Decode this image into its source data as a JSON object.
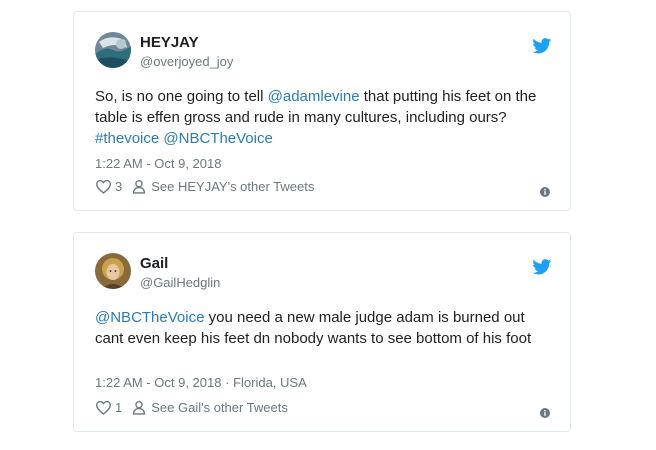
{
  "tweets": [
    {
      "name": "HEYJAY",
      "handle": "@overjoyed_joy",
      "text_parts": {
        "p1": "So, is no one going to tell ",
        "mention1": "@adamlevine",
        "p2": " that putting his feet on the table is effen gross and rude in many cultures, including ours? ",
        "hashtag": "#thevoice",
        "p3": " ",
        "mention2": "@NBCTheVoice"
      },
      "timestamp": "1:22 AM - Oct 9, 2018",
      "location": "",
      "likes": "3",
      "other_tweets": "See HEYJAY's other Tweets"
    },
    {
      "name": "Gail",
      "handle": "@GailHedglin",
      "text_parts": {
        "mention1": "@NBCTheVoice",
        "p1": " you need a new male judge adam is burned out cant even keep his feet dn nobody wants to see bottom of his foot"
      },
      "timestamp": "1:22 AM - Oct 9, 2018",
      "separator": "·",
      "location": "Florida, USA",
      "likes": "1",
      "other_tweets": "See Gail's other Tweets"
    }
  ],
  "icons": {
    "bird": "twitter-bird-icon",
    "heart": "heart-icon",
    "person": "person-icon",
    "info": "info-icon"
  },
  "colors": {
    "twitter_blue": "#1da1f2",
    "link": "#2b7bb9",
    "muted": "#697882",
    "border": "#e1e8ed"
  }
}
